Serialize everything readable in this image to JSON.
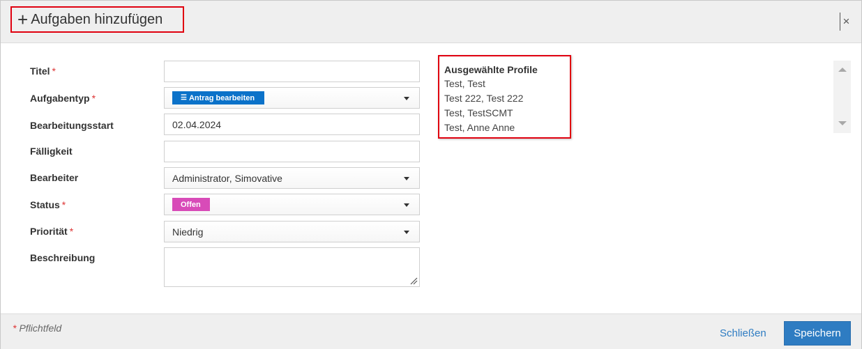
{
  "header": {
    "plus_glyph": "+",
    "title": "Aufgaben hinzufügen",
    "close_glyph": "×"
  },
  "form": {
    "titel": {
      "label": "Titel",
      "required": "*",
      "value": ""
    },
    "aufgabentyp": {
      "label": "Aufgabentyp",
      "required": "*",
      "value": "Antrag bearbeiten",
      "tag_color": "#0b72c9",
      "icon": "list-icon"
    },
    "bearbeitungsstart": {
      "label": "Bearbeitungsstart",
      "value": "02.04.2024"
    },
    "faelligkeit": {
      "label": "Fälligkeit",
      "value": ""
    },
    "bearbeiter": {
      "label": "Bearbeiter",
      "value": "Administrator, Simovative"
    },
    "status": {
      "label": "Status",
      "required": "*",
      "value": "Offen",
      "tag_color": "#d84bb8"
    },
    "prioritaet": {
      "label": "Priorität",
      "required": "*",
      "value": "Niedrig"
    },
    "beschreibung": {
      "label": "Beschreibung",
      "value": ""
    }
  },
  "profiles": {
    "heading": "Ausgewählte Profile",
    "items": [
      "Test, Test",
      "Test 222, Test 222",
      "Test, TestSCMT",
      "Test, Anne Anne"
    ]
  },
  "footer": {
    "required_star": "*",
    "required_note": "Pflichtfeld",
    "close_label": "Schließen",
    "save_label": "Speichern"
  },
  "colors": {
    "accent": "#2e7cc2",
    "highlight_border": "#e0000f",
    "required": "#d33"
  }
}
